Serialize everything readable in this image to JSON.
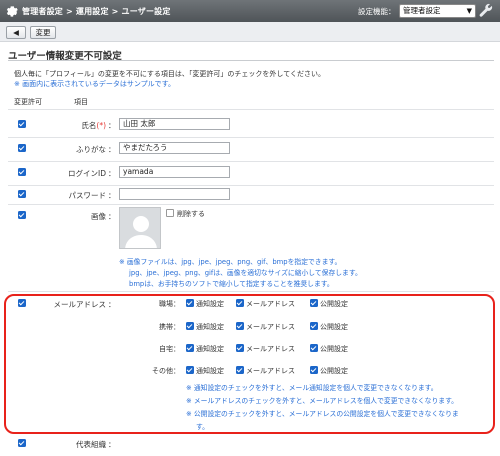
{
  "topbar": {
    "breadcrumb": "管理者設定 > 運用設定 > ユーザー設定",
    "setting_label": "設定機能：",
    "setting_value": "管理者設定"
  },
  "toolbar": {
    "back_label": "◀",
    "change_label": "変更"
  },
  "page": {
    "title": "ユーザー情報変更不可設定",
    "description": "個人毎に「プロフィール」の変更を不可にする項目は、「変更許可」のチェックを外してください。",
    "sample_note": "※ 画面内に表示されているデータはサンプルです。",
    "col_permission": "変更許可",
    "col_item": "項目"
  },
  "fields": {
    "name": {
      "label": "氏名",
      "req": "(*)",
      "value": "山田 太郎"
    },
    "kana": {
      "label": "ふりがな",
      "value": "やまだたろう"
    },
    "login": {
      "label": "ログインID",
      "value": "yamada"
    },
    "password": {
      "label": "パスワード",
      "value": ""
    },
    "image": {
      "label": "画像",
      "delete_label": "削除する"
    }
  },
  "image_notes": [
    "※ 画像ファイルは、jpg、jpe、jpeg、png、gif、bmpを指定できます。",
    "jpg、jpe、jpeg、png、gifは、画像を適切なサイズに縮小して保存します。",
    "bmpは、お手持ちのソフトで縮小して指定することを推奨します。"
  ],
  "mail": {
    "label": "メールアドレス",
    "rows": [
      {
        "name": "職場"
      },
      {
        "name": "携帯"
      },
      {
        "name": "自宅"
      },
      {
        "name": "その他"
      }
    ],
    "opt_notify": "通知設定",
    "opt_mail": "メールアドレス",
    "opt_public": "公開設定",
    "notes": [
      "※ 通知設定のチェックを外すと、メール通知設定を個人で変更できなくなります。",
      "※ メールアドレスのチェックを外すと、メールアドレスを個人で変更できなくなります。",
      "※ 公開設定のチェックを外すと、メールアドレスの公開設定を個人で変更できなくなりま",
      "す。"
    ]
  },
  "last_field": {
    "label": "代表組織"
  },
  "colors": {
    "accent": "#1b66c9",
    "highlight": "#e8221b",
    "note": "#2a6fd6"
  }
}
